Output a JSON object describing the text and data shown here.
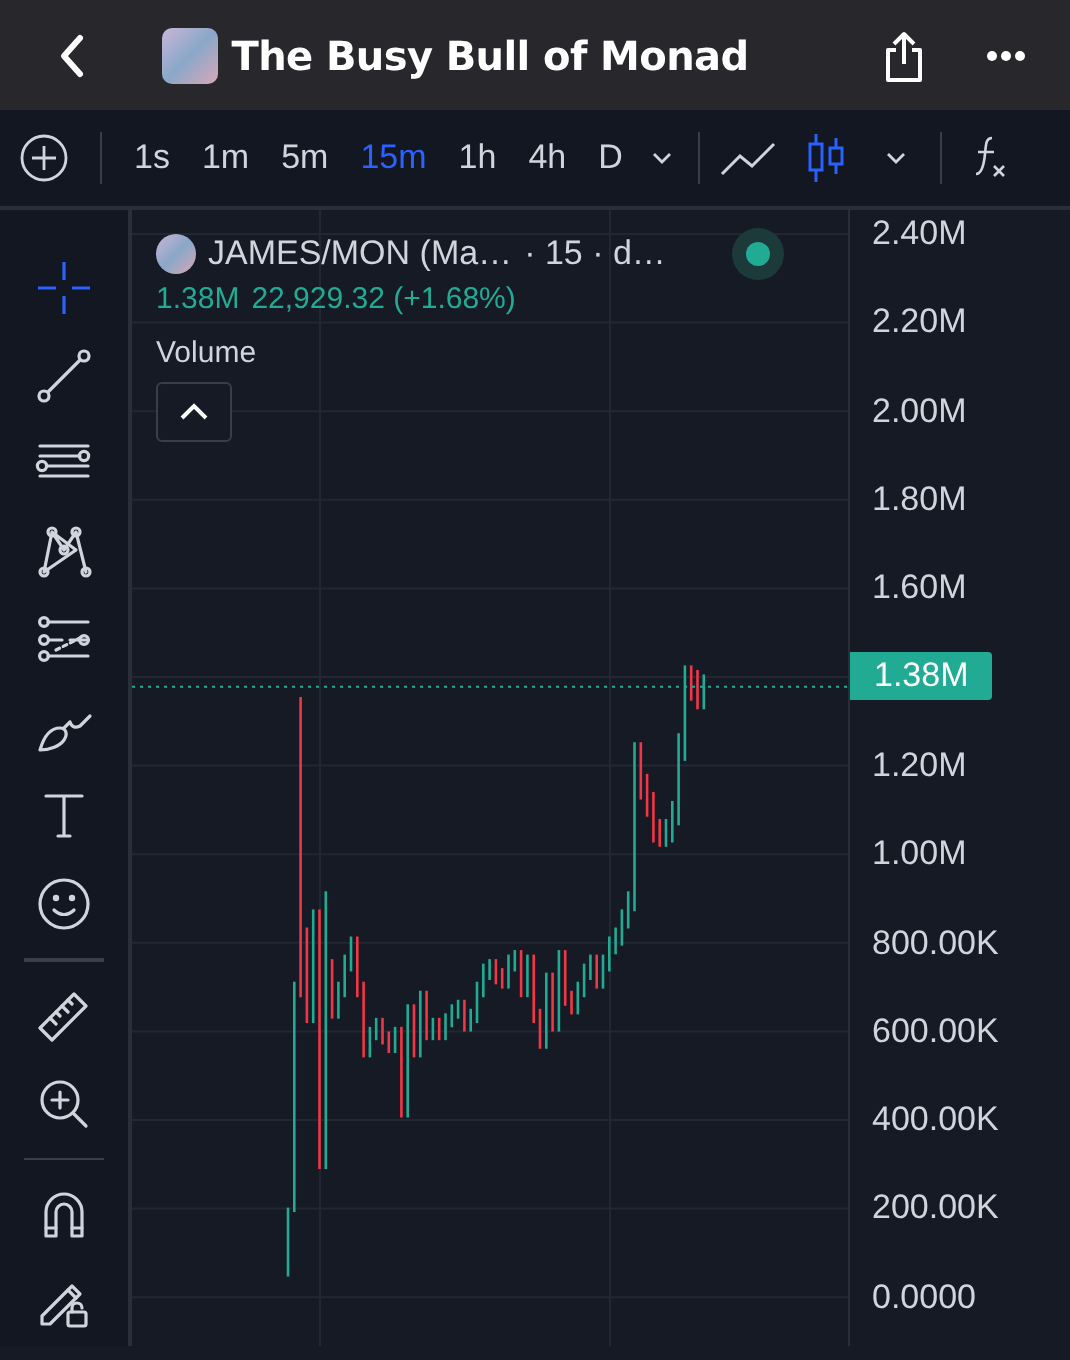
{
  "header": {
    "title": "The Busy Bull of Monad"
  },
  "toolbar": {
    "intervals": [
      {
        "label": "1s",
        "selected": false
      },
      {
        "label": "1m",
        "selected": false
      },
      {
        "label": "5m",
        "selected": false
      },
      {
        "label": "15m",
        "selected": true
      },
      {
        "label": "1h",
        "selected": false
      },
      {
        "label": "4h",
        "selected": false
      },
      {
        "label": "D",
        "selected": false
      }
    ],
    "chart_types": [
      {
        "kind": "line",
        "selected": false
      },
      {
        "kind": "candles",
        "selected": true
      }
    ]
  },
  "drawing_tools": [
    {
      "kind": "crosshair",
      "selected": true
    },
    {
      "kind": "trend-line",
      "selected": false
    },
    {
      "kind": "lines",
      "selected": false
    },
    {
      "kind": "pattern",
      "selected": false
    },
    {
      "kind": "fib",
      "selected": false
    },
    {
      "kind": "brush",
      "selected": false
    },
    {
      "kind": "text",
      "selected": false
    },
    {
      "kind": "emoji",
      "selected": false
    },
    {
      "kind": "divider"
    },
    {
      "kind": "ruler",
      "selected": false
    },
    {
      "kind": "zoom",
      "selected": false
    },
    {
      "kind": "divider"
    },
    {
      "kind": "magnet",
      "selected": false
    },
    {
      "kind": "lock",
      "selected": false
    }
  ],
  "legend": {
    "symbol": "JAMES/MON (Ma…",
    "interval": "· 15 · d…",
    "live": true,
    "last": "1.38M",
    "change": "22,929.32 (+1.68%)",
    "indicator": "Volume"
  },
  "price_axis": {
    "labels_above": [
      "2.40M",
      "2.20M",
      "2.00M",
      "1.80M",
      "1.60M"
    ],
    "current_price": "1.38M",
    "labels_below": [
      "1.20M",
      "1.00M",
      "800.00K",
      "600.00K",
      "400.00K",
      "200.00K",
      "0.0000"
    ]
  }
}
